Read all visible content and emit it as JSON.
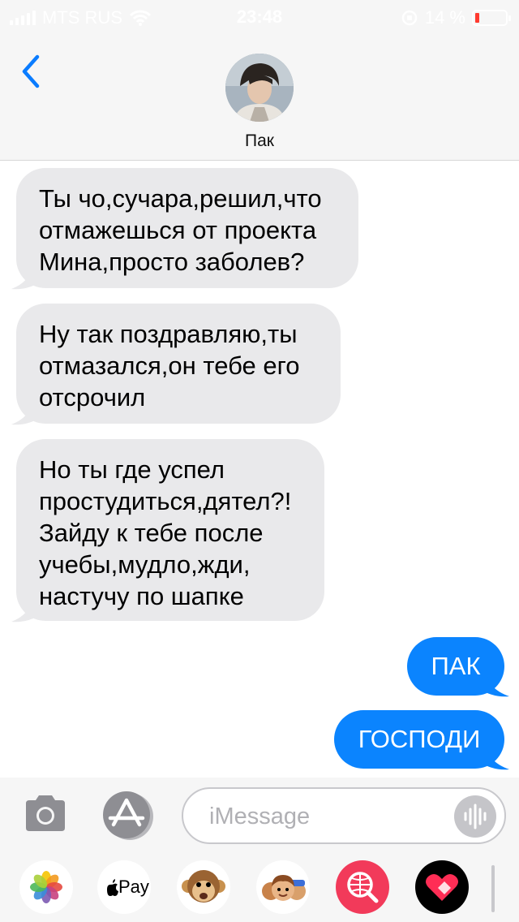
{
  "status_bar": {
    "carrier": "MTS RUS",
    "time": "23:48",
    "battery_percent": "14 %",
    "battery_level": 0.14
  },
  "header": {
    "contact_name": "Пак"
  },
  "messages": [
    {
      "direction": "incoming",
      "text_lines": [
        "Ты чо,сучара,решил,что",
        "отмажешься от проекта",
        "Мина,просто заболев?"
      ]
    },
    {
      "direction": "incoming",
      "text_lines": [
        "Ну так поздравляю,ты",
        "отмазался,он тебе его",
        "отсрочил"
      ]
    },
    {
      "direction": "incoming",
      "text_lines": [
        "Но ты где успел",
        "простудиться,дятел?!",
        "Зайду к тебе после",
        "учебы,мудло,жди,",
        "настучу по шапке"
      ]
    },
    {
      "direction": "outgoing",
      "text_lines": [
        "ПАК"
      ]
    },
    {
      "direction": "outgoing",
      "text_lines": [
        "ГОСПОДИ"
      ]
    }
  ],
  "input": {
    "placeholder": "iMessage"
  },
  "app_drawer": {
    "apple_pay_label": "Pay"
  },
  "colors": {
    "incoming_bubble": "#e9e9eb",
    "outgoing_bubble": "#0b84fe",
    "accent": "#0a7cff"
  },
  "icons": [
    "back-chevron-icon",
    "camera-icon",
    "app-store-icon",
    "voice-waveform-icon",
    "photos-icon",
    "apple-pay-icon",
    "animoji-monkey-icon",
    "memoji-icon",
    "web-search-icon",
    "digital-touch-icon"
  ]
}
